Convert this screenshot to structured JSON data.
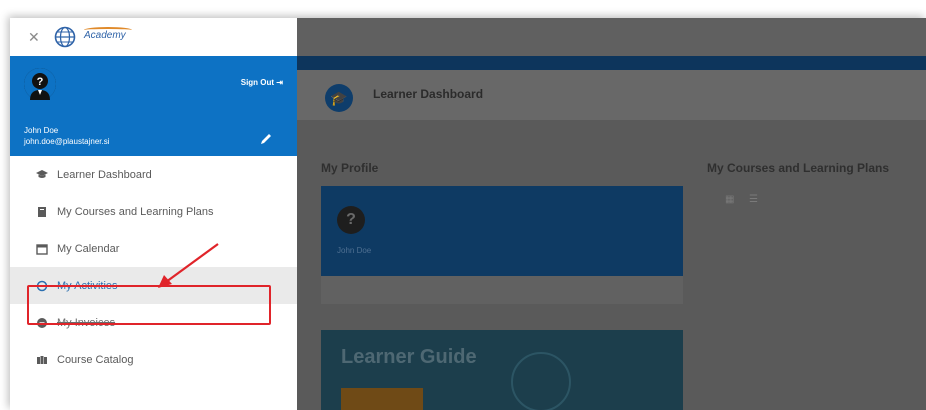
{
  "topbar": {
    "text": ""
  },
  "drawer": {
    "close_icon": "close-icon",
    "logo_text": "Academy",
    "user": {
      "name": "John Doe",
      "email": "john.doe@plaustajner.si",
      "sign_out": "Sign Out"
    },
    "nav": [
      {
        "label": "Learner Dashboard",
        "icon": "graduation-cap-icon"
      },
      {
        "label": "My Courses and Learning Plans",
        "icon": "book-icon"
      },
      {
        "label": "My Calendar",
        "icon": "calendar-icon"
      },
      {
        "label": "My Activities",
        "icon": "circle-icon",
        "active": true
      },
      {
        "label": "My Invoices",
        "icon": "invoice-icon"
      },
      {
        "label": "Course Catalog",
        "icon": "catalog-icon"
      }
    ]
  },
  "main": {
    "dashboard": {
      "title": "Learner Dashboard",
      "subtitle": ""
    },
    "my_profile_title": "My Profile",
    "my_courses_title": "My Courses and Learning Plans",
    "profile_card": {
      "name": "John Doe",
      "actions": [
        "",
        ""
      ]
    },
    "guide": {
      "title": "Learner Guide",
      "button": ""
    }
  },
  "colors": {
    "drawer_blue": "#0d72c4",
    "dark_navy": "#0d355c",
    "active_text": "#2b6fb0",
    "highlight_red": "#e0242a"
  }
}
